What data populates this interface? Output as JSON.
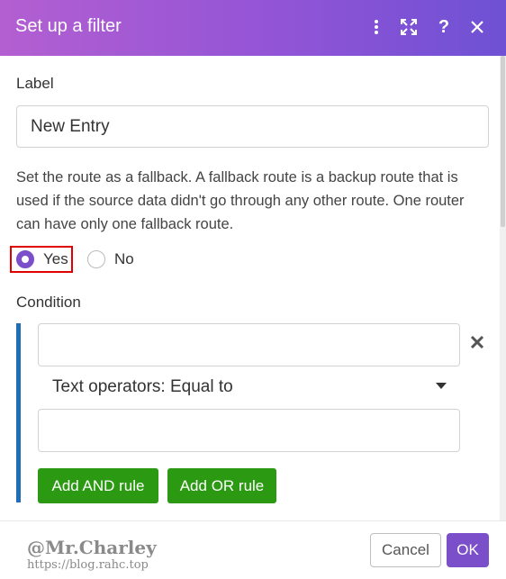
{
  "dialog": {
    "title": "Set up a filter",
    "header_icons": [
      "more-vertical-icon",
      "expand-icon",
      "help-icon",
      "close-icon"
    ],
    "help_glyph": "?"
  },
  "label_section": {
    "label": "Label",
    "value": "New Entry"
  },
  "fallback": {
    "description": "Set the route as a fallback. A fallback route is a backup route that is used if the source data didn't go through any other route. One router can have only one fallback route.",
    "options": [
      {
        "label": "Yes",
        "checked": true
      },
      {
        "label": "No",
        "checked": false
      }
    ]
  },
  "condition": {
    "label": "Condition",
    "first_operand": "",
    "operator": "Text operators: Equal to",
    "second_operand": "",
    "add_and_label": "Add AND rule",
    "add_or_label": "Add OR rule"
  },
  "footer": {
    "watermark_name": "@Mr.Charley",
    "watermark_url": "https://blog.rahc.top",
    "cancel_label": "Cancel",
    "ok_label": "OK"
  },
  "colors": {
    "header_gradient_start": "#b35fd1",
    "header_gradient_end": "#6e51d4",
    "accent_purple": "#7a4fc9",
    "green_button": "#2b9a12",
    "condition_bar": "#1f6fb8",
    "highlight_red": "#e00000"
  }
}
